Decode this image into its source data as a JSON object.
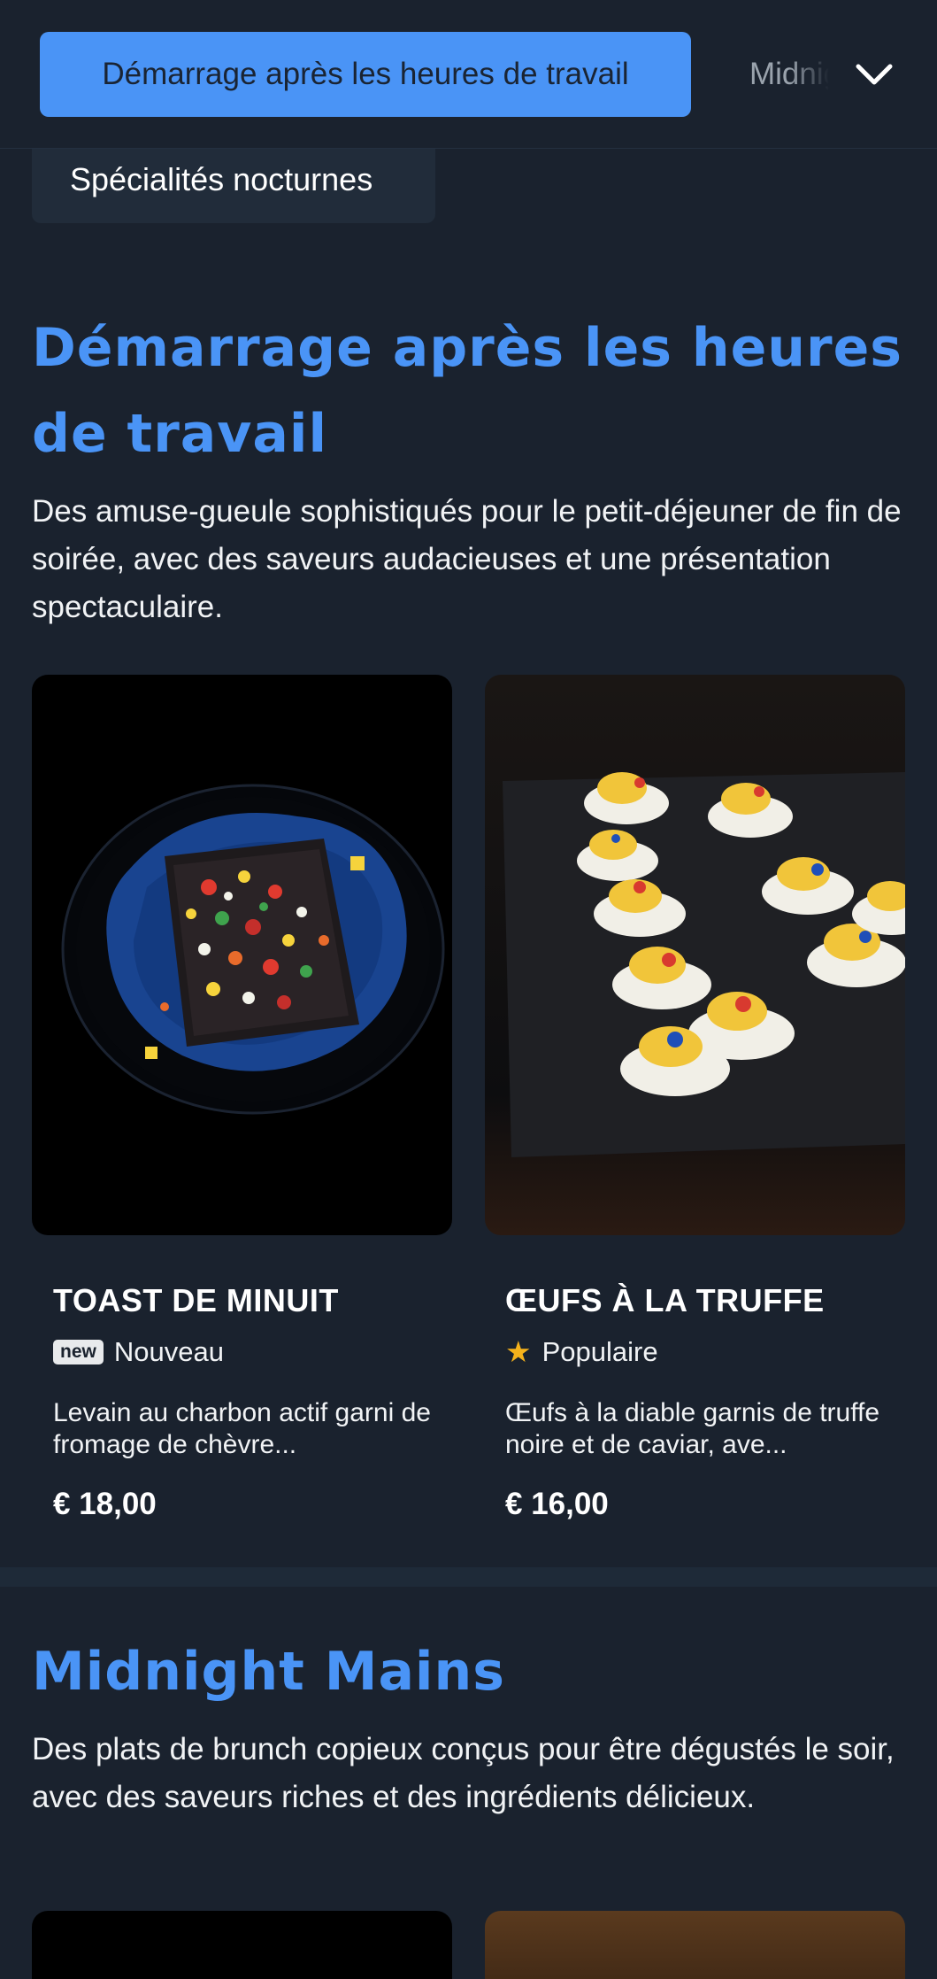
{
  "nav": {
    "active_tab": "Démarrage après les heures de travail",
    "next_tab": "Midnight Mains",
    "chip_label": "Spécialités nocturnes"
  },
  "sections": [
    {
      "title": "Démarrage après les heures de travail",
      "description": "Des amuse-gueule sophistiqués pour le petit-déjeuner de fin de soirée, avec des saveurs audacieuses et une présentation spectaculaire.",
      "items": [
        {
          "name": "TOAST DE MINUIT",
          "badge_icon": "new",
          "badge_label": "Nouveau",
          "description": "Levain au charbon actif garni de fromage de chèvre...",
          "price": "€ 18,00"
        },
        {
          "name": "ŒUFS À LA TRUFFE",
          "badge_icon": "★",
          "badge_label": "Populaire",
          "description": "Œufs à la diable garnis de truffe noire et de caviar, ave...",
          "price": "€ 16,00"
        }
      ]
    },
    {
      "title": "Midnight Mains",
      "description": "Des plats de brunch copieux conçus pour être dégustés le soir, avec des saveurs riches et des ingrédients délicieux."
    }
  ],
  "colors": {
    "background": "#1a222e",
    "accent": "#4a94f6",
    "star": "#f5b21b"
  },
  "icons": {
    "dropdown": "chevron-down-icon",
    "popular": "star-icon",
    "new": "new-badge-icon"
  }
}
